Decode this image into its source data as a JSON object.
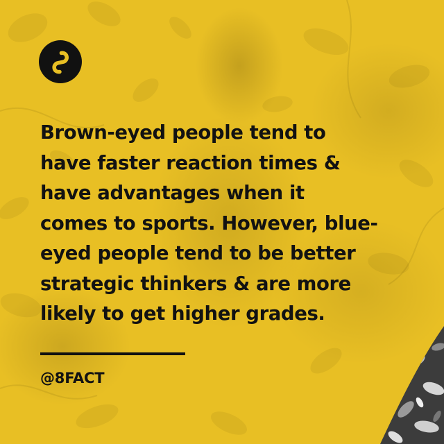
{
  "brand": {
    "logo_icon": "infinity-eight-logo-icon",
    "logo_bg": "#111111",
    "logo_fg": "#e8bf24"
  },
  "fact": {
    "lines": [
      "Brown-eyed people tend to",
      "have faster reaction times &",
      "have advantages when it",
      "comes to sports. However, blue-",
      "eyed people tend to be better",
      "strategic thinkers & are more",
      "likely to get higher grades."
    ]
  },
  "footer": {
    "handle": "@8FACT"
  },
  "colors": {
    "background": "#e8bf24",
    "text": "#121212"
  }
}
